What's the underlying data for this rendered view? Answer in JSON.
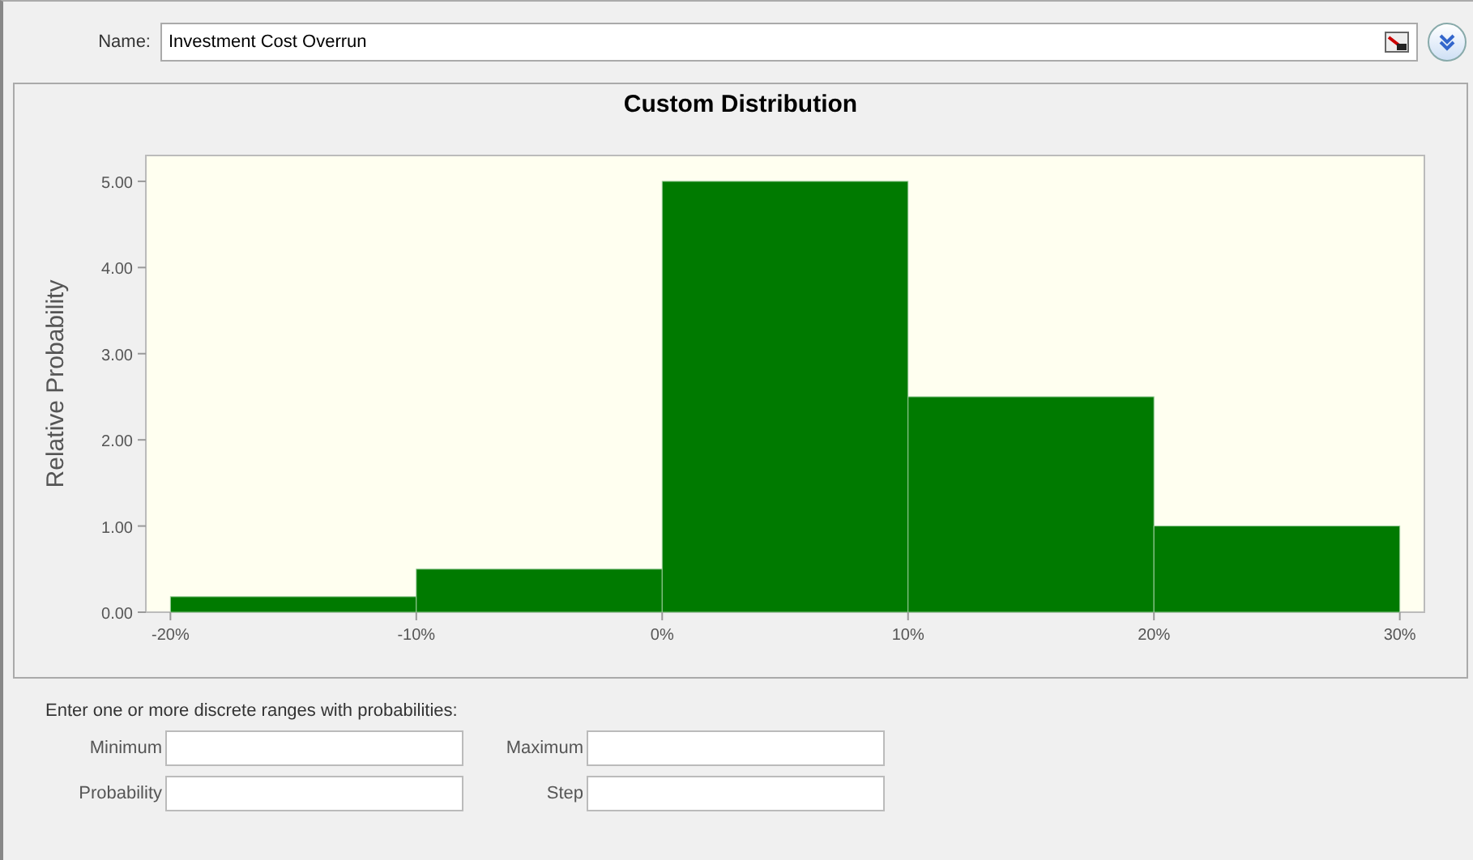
{
  "name_field": {
    "label": "Name:",
    "value": "Investment Cost Overrun"
  },
  "chart": {
    "title": "Custom Distribution",
    "chart_data": {
      "type": "bar",
      "ylabel": "Relative Probability",
      "x": [
        -15,
        -5,
        5,
        15,
        25
      ],
      "xlim": [
        -21,
        31
      ],
      "ylim": [
        0,
        5.3
      ],
      "xticks": [
        {
          "value": -20,
          "label": "-20%"
        },
        {
          "value": -10,
          "label": "-10%"
        },
        {
          "value": 0,
          "label": "0%"
        },
        {
          "value": 10,
          "label": "10%"
        },
        {
          "value": 20,
          "label": "20%"
        },
        {
          "value": 30,
          "label": "30%"
        }
      ],
      "yticks": [
        {
          "value": 0,
          "label": "0.00"
        },
        {
          "value": 1,
          "label": "1.00"
        },
        {
          "value": 2,
          "label": "2.00"
        },
        {
          "value": 3,
          "label": "3.00"
        },
        {
          "value": 4,
          "label": "4.00"
        },
        {
          "value": 5,
          "label": "5.00"
        }
      ],
      "series": [
        {
          "color": "#007a00",
          "values": [
            0.18,
            0.5,
            5.0,
            2.5,
            1.0
          ]
        }
      ]
    }
  },
  "ranges": {
    "instruction": "Enter one or more discrete ranges with probabilities:",
    "fields": [
      {
        "label": "Minimum"
      },
      {
        "label": "Maximum"
      },
      {
        "label": "Probability"
      },
      {
        "label": "Step"
      }
    ]
  }
}
